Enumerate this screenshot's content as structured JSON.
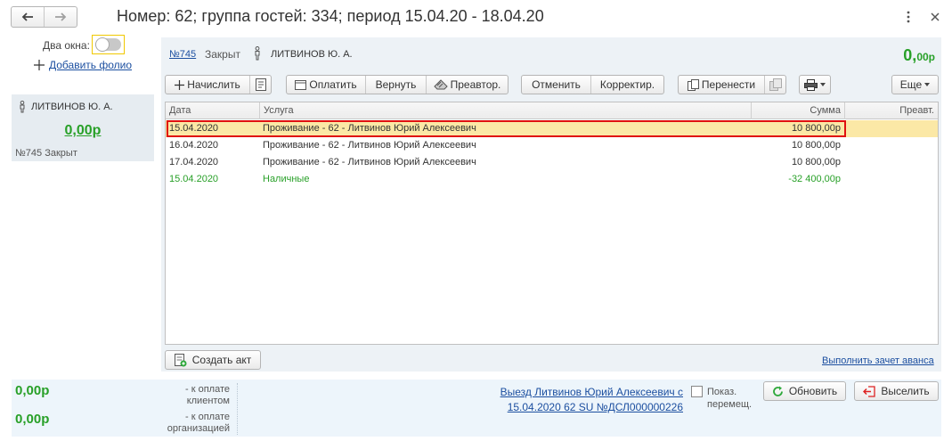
{
  "window": {
    "title": "Номер: 62; группа гостей: 334; период 15.04.20 - 18.04.20"
  },
  "left": {
    "two_windows_label": "Два окна:",
    "add_folio_label": "Добавить фолио",
    "guest": {
      "name": "ЛИТВИНОВ Ю. А.",
      "amount": "0,00р",
      "folio": "№745",
      "status": "Закрыт"
    }
  },
  "header": {
    "folio": "№745",
    "status": "Закрыт",
    "name": "ЛИТВИНОВ Ю. А.",
    "amount_int": "0,",
    "amount_frac": "00р"
  },
  "toolbar": {
    "charge": "Начислить",
    "pay": "Оплатить",
    "refund": "Вернуть",
    "preauth": "Преавтор.",
    "cancel": "Отменить",
    "correct": "Корректир.",
    "transfer": "Перенести",
    "more": "Еще"
  },
  "table": {
    "columns": [
      "Дата",
      "Услуга",
      "Сумма",
      "Преавт."
    ],
    "rows": [
      {
        "date": "15.04.2020",
        "service": "Проживание - 62 - Литвинов Юрий Алексеевич",
        "sum": "10 800,00р",
        "preauth": ""
      },
      {
        "date": "16.04.2020",
        "service": "Проживание - 62 - Литвинов Юрий Алексеевич",
        "sum": "10 800,00р",
        "preauth": ""
      },
      {
        "date": "17.04.2020",
        "service": "Проживание - 62 - Литвинов Юрий Алексеевич",
        "sum": "10 800,00р",
        "preauth": ""
      },
      {
        "date": "15.04.2020",
        "service": "Наличные",
        "sum": "-32 400,00р",
        "preauth": ""
      }
    ]
  },
  "actions": {
    "create_act": "Создать акт",
    "advance_offset": "Выполнить зачет аванса"
  },
  "bottom": {
    "client_amount": "0,00р",
    "client_label": "- к оплате клиентом",
    "org_amount": "0,00р",
    "org_label": "- к оплате организацией",
    "depart_line1": "Выезд Литвинов Юрий Алексеевич с",
    "depart_line2": "15.04.2020 62 SU №ДСЛ000000226",
    "show_moves_line1": "Показ.",
    "show_moves_line2": "перемещ.",
    "refresh": "Обновить",
    "checkout": "Выселить"
  },
  "colors": {
    "accent_green": "#28a028",
    "link_blue": "#1c4fa0",
    "selection": "#fbe8a6",
    "highlight_border": "#e01010"
  }
}
